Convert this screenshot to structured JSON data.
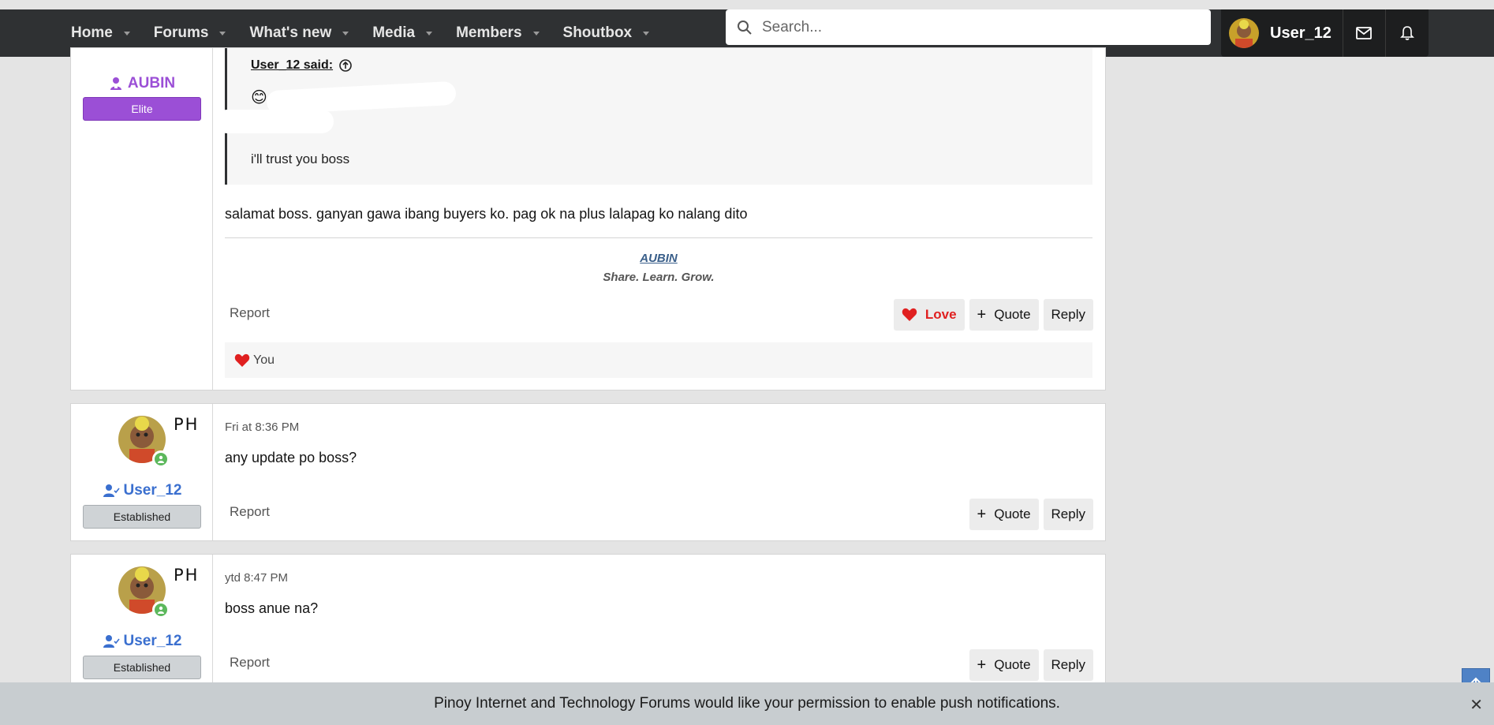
{
  "nav": {
    "items": [
      {
        "label": "Home"
      },
      {
        "label": "Forums"
      },
      {
        "label": "What's new"
      },
      {
        "label": "Media"
      },
      {
        "label": "Members"
      },
      {
        "label": "Shoutbox"
      }
    ],
    "search_placeholder": "Search...",
    "current_user": "User_12"
  },
  "posts": [
    {
      "username": "AUBIN",
      "rank": "Elite",
      "quote_author": "User_12 said:",
      "quote_emoji": "😊",
      "quote_text": "i'll trust you boss",
      "body": "salamat boss. ganyan gawa ibang buyers ko. pag ok na plus lalapag ko nalang dito",
      "signature_name": "AUBIN",
      "signature_tagline": "Share. Learn. Grow.",
      "report_label": "Report",
      "love_label": "Love",
      "quote_label": "Quote",
      "reply_label": "Reply",
      "reaction_by": "You"
    },
    {
      "username": "User_12",
      "rank": "Established",
      "flag": "PH",
      "date": "Fri at 8:36 PM",
      "body": "any update po boss?",
      "report_label": "Report",
      "quote_label": "Quote",
      "reply_label": "Reply"
    },
    {
      "username": "User_12",
      "rank": "Established",
      "flag": "PH",
      "date": "ytd 8:47 PM",
      "body": "boss anue na?",
      "report_label": "Report",
      "quote_label": "Quote",
      "reply_label": "Reply"
    }
  ],
  "push_notice": "Pinoy Internet and Technology Forums would like your permission to enable push notifications.",
  "colors": {
    "nav_bg": "#2f3133",
    "elite_badge": "#9b4fd6",
    "elite_name": "#9b4fd6",
    "user_name": "#3a6fcf",
    "love": "#e02020"
  }
}
